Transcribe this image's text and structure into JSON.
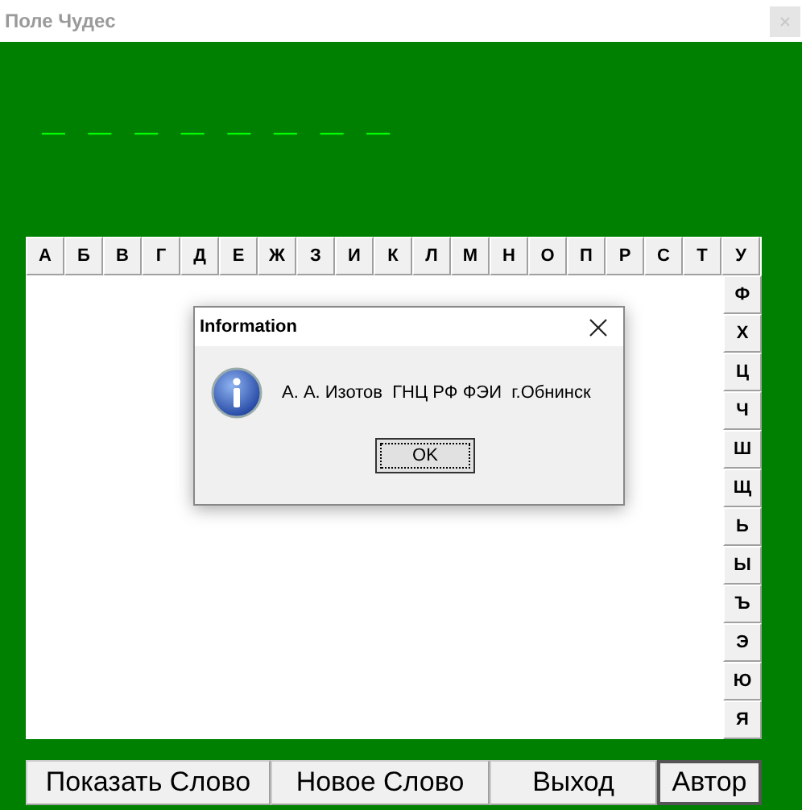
{
  "window": {
    "title": "Поле Чудес"
  },
  "word_mask": "_ _ _ _ _ _ _ _",
  "letters_top": [
    "А",
    "Б",
    "В",
    "Г",
    "Д",
    "Е",
    "Ж",
    "З",
    "И",
    "К",
    "Л",
    "М",
    "Н",
    "О",
    "П",
    "Р",
    "С",
    "Т",
    "У"
  ],
  "letters_side": [
    "Ф",
    "Х",
    "Ц",
    "Ч",
    "Ш",
    "Щ",
    "Ь",
    "Ы",
    "Ъ",
    "Э",
    "Ю",
    "Я"
  ],
  "dialog": {
    "title": "Information",
    "message": "А. А. Изотов  ГНЦ РФ ФЭИ  г.Обнинск",
    "button": "OK"
  },
  "buttons": [
    {
      "label": "Показать Слово",
      "focused": false
    },
    {
      "label": "Новое Слово",
      "focused": false
    },
    {
      "label": "Выход",
      "focused": false
    },
    {
      "label": "Автор",
      "focused": true
    }
  ]
}
